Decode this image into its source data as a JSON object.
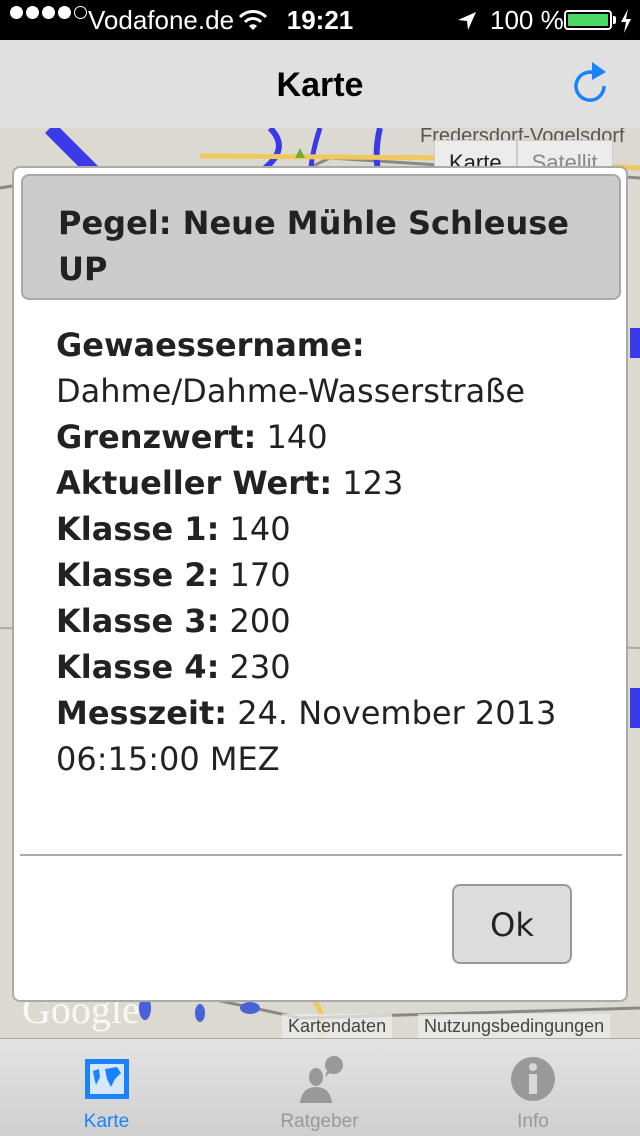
{
  "status_bar": {
    "signal_dots_filled": 4,
    "signal_dots_total": 5,
    "carrier": "Vodafone.de",
    "time": "19:21",
    "battery_percent_label": "100 %",
    "battery_level": 1.0,
    "icons": [
      "wifi-icon",
      "location-arrow-icon",
      "battery-icon",
      "charging-bolt-icon"
    ]
  },
  "nav_bar": {
    "title": "Karte",
    "right_button_icon": "refresh-icon",
    "accent_color": "#1a82fb"
  },
  "map": {
    "map_type_options": [
      "Karte",
      "Satellit"
    ],
    "selected_map_type": "Karte",
    "visible_labels": [
      "Fredersdorf-Vogelsdorf"
    ],
    "logo": "Google",
    "attribution_links": [
      "Kartendaten",
      "Nutzungsbedingungen"
    ]
  },
  "dialog": {
    "title": "Pegel: Neue Mühle Schleuse UP",
    "fields": [
      {
        "label": "Gewaessername:",
        "value": "Dahme/Dahme-Wasserstraße"
      },
      {
        "label": "Grenzwert:",
        "value": "140"
      },
      {
        "label": "Aktueller Wert:",
        "value": "123"
      },
      {
        "label": "Klasse 1:",
        "value": "140"
      },
      {
        "label": "Klasse 2:",
        "value": "170"
      },
      {
        "label": "Klasse 3:",
        "value": "200"
      },
      {
        "label": "Klasse 4:",
        "value": "230"
      },
      {
        "label": "Messzeit:",
        "value": "24. November 2013 06:15:00 MEZ"
      }
    ],
    "ok_label": "Ok"
  },
  "tab_bar": {
    "tabs": [
      {
        "label": "Karte",
        "icon": "world-map-icon",
        "active": true
      },
      {
        "label": "Ratgeber",
        "icon": "advisor-speech-icon",
        "active": false
      },
      {
        "label": "Info",
        "icon": "info-icon",
        "active": false
      }
    ]
  }
}
